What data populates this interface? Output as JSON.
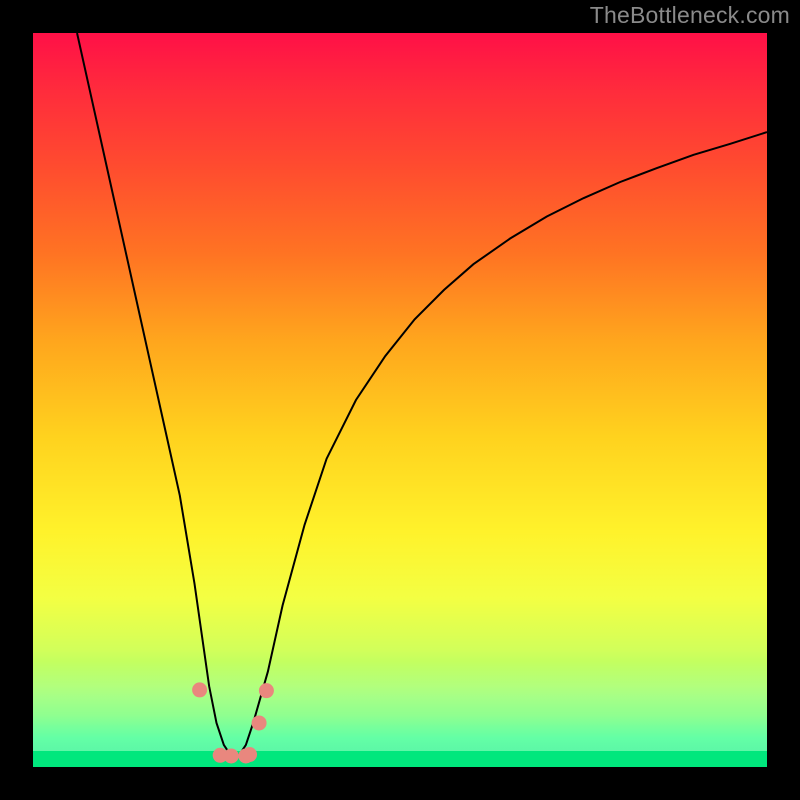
{
  "watermark": "TheBottleneck.com",
  "colors": {
    "frame": "#000000",
    "curve": "#000000",
    "marker_fill": "#e9877e",
    "marker_stroke": "#d26b63"
  },
  "chart_data": {
    "type": "line",
    "title": "",
    "xlabel": "",
    "ylabel": "",
    "xlim": [
      0,
      100
    ],
    "ylim": [
      0,
      100
    ],
    "curve": {
      "x": [
        6,
        8,
        10,
        12,
        14,
        16,
        18,
        20,
        21,
        22,
        23,
        24,
        25,
        26,
        27,
        28,
        29,
        30,
        32,
        34,
        37,
        40,
        44,
        48,
        52,
        56,
        60,
        65,
        70,
        75,
        80,
        85,
        90,
        95,
        100
      ],
      "y": [
        100,
        91,
        82,
        73,
        64,
        55,
        46,
        37,
        31,
        25,
        18,
        11,
        6,
        3,
        1.5,
        1.5,
        3,
        6,
        13,
        22,
        33,
        42,
        50,
        56,
        61,
        65,
        68.5,
        72,
        75,
        77.5,
        79.7,
        81.6,
        83.4,
        84.9,
        86.5
      ]
    },
    "series": [
      {
        "name": "markers",
        "x": [
          22.7,
          25.5,
          27.0,
          29.0,
          29.5,
          30.8,
          31.8
        ],
        "y": [
          10.5,
          1.6,
          1.5,
          1.5,
          1.7,
          6.0,
          10.4
        ]
      }
    ]
  }
}
